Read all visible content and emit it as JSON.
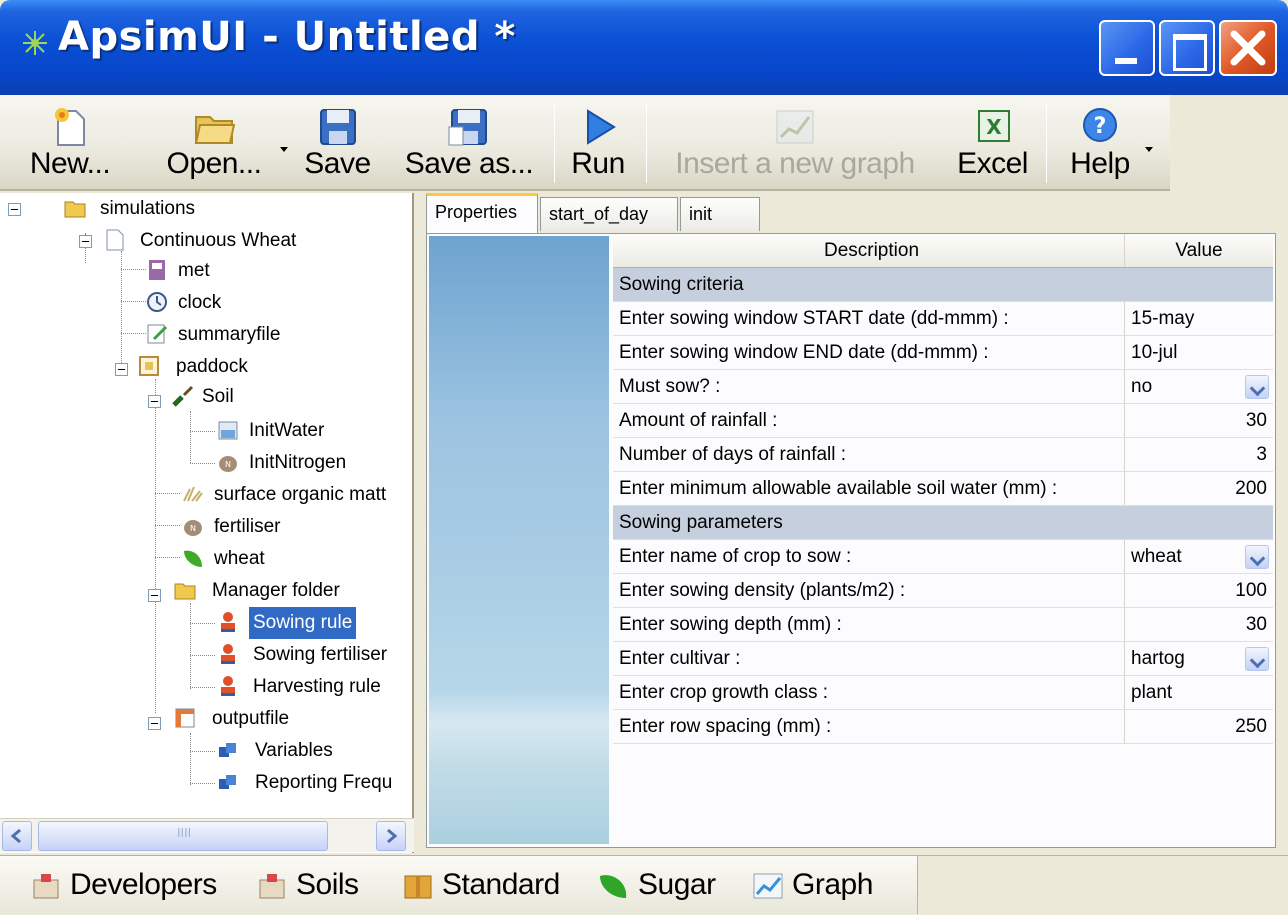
{
  "window": {
    "title": "ApsimUI - Untitled *"
  },
  "toolbar": {
    "new_label": "New...",
    "open_label": "Open...",
    "save_label": "Save",
    "save_as_label": "Save as...",
    "run_label": "Run",
    "insert_graph_label": "Insert a new graph",
    "excel_label": "Excel",
    "help_label": "Help"
  },
  "tree": {
    "simulations": "simulations",
    "continuous_wheat": "Continuous Wheat",
    "met": "met",
    "clock": "clock",
    "summaryfile": "summaryfile",
    "paddock": "paddock",
    "soil": "Soil",
    "initwater": "InitWater",
    "initnitrogen": "InitNitrogen",
    "surface_organic": "surface organic matt",
    "fertiliser": "fertiliser",
    "wheat": "wheat",
    "manager_folder": "Manager folder",
    "sowing_rule": "Sowing rule",
    "sowing_fertiliser": "Sowing fertiliser",
    "harvesting_rule": "Harvesting rule",
    "outputfile": "outputfile",
    "variables": "Variables",
    "reporting_frequency": "Reporting Frequ"
  },
  "tabs": [
    {
      "label": "Properties"
    },
    {
      "label": "start_of_day"
    },
    {
      "label": "init"
    }
  ],
  "grid": {
    "header": {
      "description": "Description",
      "value": "Value"
    },
    "rows": [
      {
        "description": "Sowing criteria",
        "value": ""
      },
      {
        "description": "Enter sowing window START date (dd-mmm) :",
        "value": "15-may"
      },
      {
        "description": "Enter sowing window END date (dd-mmm) :",
        "value": "10-jul"
      },
      {
        "description": "Must sow? :",
        "value": "no"
      },
      {
        "description": "Amount of rainfall :",
        "value": "30"
      },
      {
        "description": "Number of days of rainfall :",
        "value": "3"
      },
      {
        "description": "Enter minimum allowable available soil water (mm) :",
        "value": "200"
      },
      {
        "description": "Sowing parameters",
        "value": ""
      },
      {
        "description": "Enter name of crop to sow :",
        "value": "wheat"
      },
      {
        "description": "Enter sowing density  (plants/m2) :",
        "value": "100"
      },
      {
        "description": "Enter sowing depth  (mm) :",
        "value": "30"
      },
      {
        "description": "Enter cultivar :",
        "value": "hartog"
      },
      {
        "description": "Enter crop growth class :",
        "value": "plant"
      },
      {
        "description": "Enter row spacing (mm) :",
        "value": "250"
      }
    ]
  },
  "bottom_tabs": {
    "developers": "Developers",
    "soils": "Soils",
    "standard": "Standard",
    "sugar": "Sugar",
    "graph": "Graph"
  },
  "scrollbar": {
    "grip": "IIII"
  }
}
